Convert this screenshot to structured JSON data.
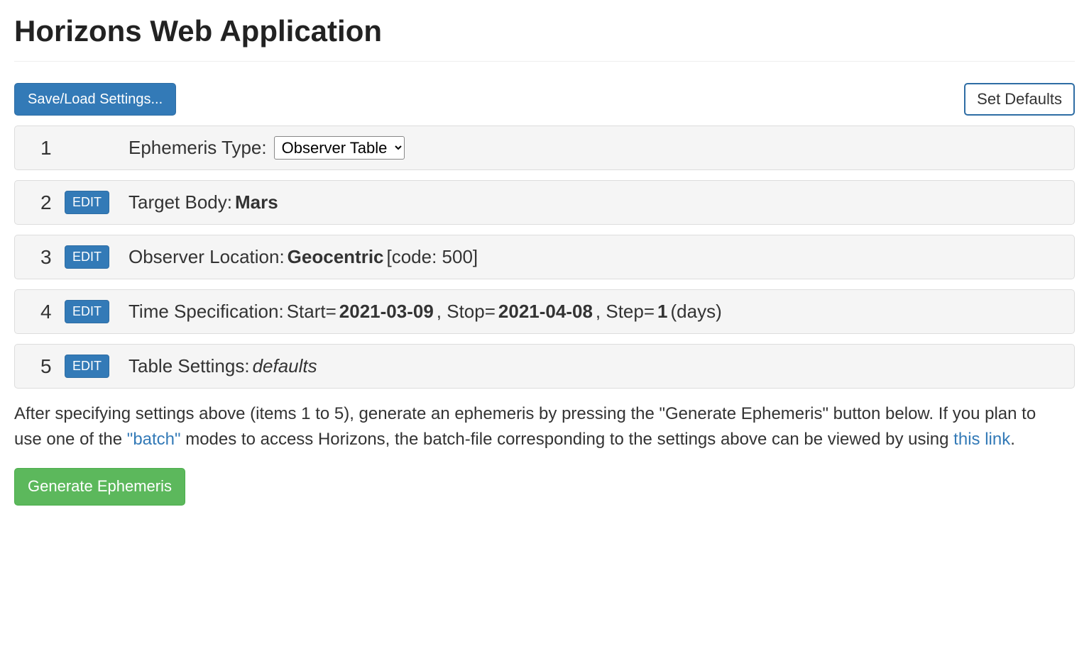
{
  "title": "Horizons Web Application",
  "top_bar": {
    "save_load": "Save/Load Settings...",
    "set_defaults": "Set Defaults"
  },
  "edit_label": "EDIT",
  "rows": {
    "r1": {
      "num": "1",
      "label": "Ephemeris Type: ",
      "select_value": "Observer Table"
    },
    "r2": {
      "num": "2",
      "label": "Target Body: ",
      "value": "Mars"
    },
    "r3": {
      "num": "3",
      "label": "Observer Location: ",
      "value": "Geocentric",
      "suffix": " [code: 500]"
    },
    "r4": {
      "num": "4",
      "label": "Time Specification: ",
      "start_label": "Start=",
      "start_value": "2021-03-09",
      "stop_label": ", Stop=",
      "stop_value": "2021-04-08",
      "step_label": ", Step=",
      "step_value": "1",
      "step_unit": " (days)"
    },
    "r5": {
      "num": "5",
      "label": "Table Settings: ",
      "value": "defaults"
    }
  },
  "description": {
    "part1": "After specifying settings above (items 1 to 5), generate an ephemeris by pressing the \"Generate Ephemeris\" button below. If you plan to use one of the ",
    "link1": "\"batch\"",
    "part2": " modes to access Horizons, the batch-file corresponding to the settings above can be viewed by using ",
    "link2": "this link",
    "part3": "."
  },
  "generate_button": "Generate Ephemeris"
}
